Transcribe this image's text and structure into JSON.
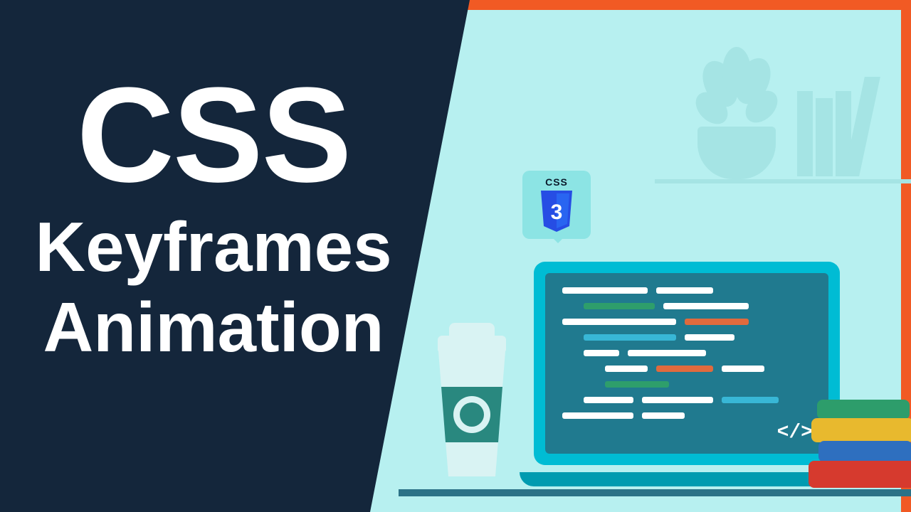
{
  "hero": {
    "line1": "CSS",
    "line2": "Keyframes",
    "line3": "Animation"
  },
  "badge": {
    "label": "CSS",
    "number": "3"
  },
  "laptop": {
    "code_symbol": "</>"
  },
  "colors": {
    "navy": "#14263b",
    "cyan_bg": "#b7f0f0",
    "orange_frame": "#f15a24",
    "laptop_teal": "#00bcd4",
    "screen_dark": "#207a8f"
  }
}
